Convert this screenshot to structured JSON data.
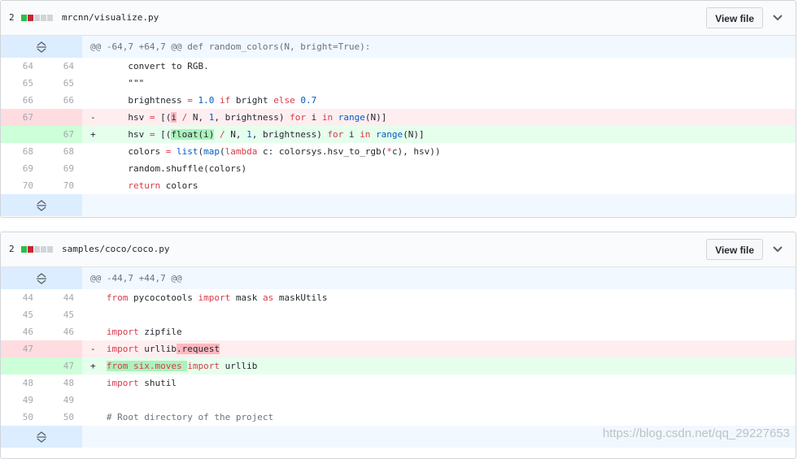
{
  "files": [
    {
      "changes": "2",
      "name": "mrcnn/visualize.py",
      "view_label": "View file",
      "hunk": "@@ -64,7 +64,7 @@ def random_colors(N, bright=True):",
      "lines": [
        {
          "old": "64",
          "new": "64",
          "sign": "",
          "type": "ctx",
          "segs": [
            {
              "t": "    convert to RGB."
            }
          ]
        },
        {
          "old": "65",
          "new": "65",
          "sign": "",
          "type": "ctx",
          "segs": [
            {
              "t": "    \"\"\""
            }
          ]
        },
        {
          "old": "66",
          "new": "66",
          "sign": "",
          "type": "ctx",
          "segs": [
            {
              "t": "    brightness "
            },
            {
              "t": "=",
              "c": "kw"
            },
            {
              "t": " "
            },
            {
              "t": "1.0",
              "c": "nm"
            },
            {
              "t": " "
            },
            {
              "t": "if",
              "c": "kw"
            },
            {
              "t": " bright "
            },
            {
              "t": "else",
              "c": "kw"
            },
            {
              "t": " "
            },
            {
              "t": "0.7",
              "c": "nm"
            }
          ]
        },
        {
          "old": "67",
          "new": "",
          "sign": "-",
          "type": "del",
          "segs": [
            {
              "t": "    hsv "
            },
            {
              "t": "=",
              "c": "kw"
            },
            {
              "t": " [("
            },
            {
              "t": "i",
              "c": "xdel"
            },
            {
              "t": " "
            },
            {
              "t": "/",
              "c": "kw"
            },
            {
              "t": " N, "
            },
            {
              "t": "1",
              "c": "nm"
            },
            {
              "t": ", brightness) "
            },
            {
              "t": "for",
              "c": "kw"
            },
            {
              "t": " i "
            },
            {
              "t": "in",
              "c": "kw"
            },
            {
              "t": " "
            },
            {
              "t": "range",
              "c": "nm"
            },
            {
              "t": "(N)]"
            }
          ]
        },
        {
          "old": "",
          "new": "67",
          "sign": "+",
          "type": "add",
          "segs": [
            {
              "t": "    hsv "
            },
            {
              "t": "=",
              "c": "kw"
            },
            {
              "t": " [("
            },
            {
              "t": "float(i)",
              "c": "xadd"
            },
            {
              "t": " "
            },
            {
              "t": "/",
              "c": "kw"
            },
            {
              "t": " N, "
            },
            {
              "t": "1",
              "c": "nm"
            },
            {
              "t": ", brightness) "
            },
            {
              "t": "for",
              "c": "kw"
            },
            {
              "t": " i "
            },
            {
              "t": "in",
              "c": "kw"
            },
            {
              "t": " "
            },
            {
              "t": "range",
              "c": "nm"
            },
            {
              "t": "(N)]"
            }
          ]
        },
        {
          "old": "68",
          "new": "68",
          "sign": "",
          "type": "ctx",
          "segs": [
            {
              "t": "    colors "
            },
            {
              "t": "=",
              "c": "kw"
            },
            {
              "t": " "
            },
            {
              "t": "list",
              "c": "nm"
            },
            {
              "t": "("
            },
            {
              "t": "map",
              "c": "nm"
            },
            {
              "t": "("
            },
            {
              "t": "lambda",
              "c": "kw"
            },
            {
              "t": " c: colorsys.hsv_to_rgb("
            },
            {
              "t": "*",
              "c": "kw"
            },
            {
              "t": "c), hsv))"
            }
          ]
        },
        {
          "old": "69",
          "new": "69",
          "sign": "",
          "type": "ctx",
          "segs": [
            {
              "t": "    random.shuffle(colors)"
            }
          ]
        },
        {
          "old": "70",
          "new": "70",
          "sign": "",
          "type": "ctx",
          "segs": [
            {
              "t": "    "
            },
            {
              "t": "return",
              "c": "kw"
            },
            {
              "t": " colors"
            }
          ]
        }
      ]
    },
    {
      "changes": "2",
      "name": "samples/coco/coco.py",
      "view_label": "View file",
      "hunk": "@@ -44,7 +44,7 @@",
      "lines": [
        {
          "old": "44",
          "new": "44",
          "sign": "",
          "type": "ctx",
          "segs": [
            {
              "t": "from",
              "c": "kw"
            },
            {
              "t": " pycocotools "
            },
            {
              "t": "import",
              "c": "kw"
            },
            {
              "t": " mask "
            },
            {
              "t": "as",
              "c": "kw"
            },
            {
              "t": " maskUtils"
            }
          ]
        },
        {
          "old": "45",
          "new": "45",
          "sign": "",
          "type": "ctx",
          "segs": [
            {
              "t": ""
            }
          ]
        },
        {
          "old": "46",
          "new": "46",
          "sign": "",
          "type": "ctx",
          "segs": [
            {
              "t": "import",
              "c": "kw"
            },
            {
              "t": " zipfile"
            }
          ]
        },
        {
          "old": "47",
          "new": "",
          "sign": "-",
          "type": "del",
          "segs": [
            {
              "t": "import",
              "c": "kw"
            },
            {
              "t": " urllib"
            },
            {
              "t": ".request",
              "c": "xdel"
            }
          ]
        },
        {
          "old": "",
          "new": "47",
          "sign": "+",
          "type": "add",
          "segs": [
            {
              "t": "from six.moves ",
              "c": "xadd kwx"
            },
            {
              "t": "import",
              "c": "kw"
            },
            {
              "t": " urllib"
            }
          ]
        },
        {
          "old": "48",
          "new": "48",
          "sign": "",
          "type": "ctx",
          "segs": [
            {
              "t": "import",
              "c": "kw"
            },
            {
              "t": " shutil"
            }
          ]
        },
        {
          "old": "49",
          "new": "49",
          "sign": "",
          "type": "ctx",
          "segs": [
            {
              "t": ""
            }
          ]
        },
        {
          "old": "50",
          "new": "50",
          "sign": "",
          "type": "ctx",
          "segs": [
            {
              "t": "# Root directory of the project",
              "c": "cm"
            }
          ]
        }
      ]
    }
  ],
  "watermark": "https://blog.csdn.net/qq_29227653",
  "colors": {
    "del_block": "#cb2431",
    "add_block": "#2cbe4e",
    "neutral_block": "#d1d5da"
  }
}
